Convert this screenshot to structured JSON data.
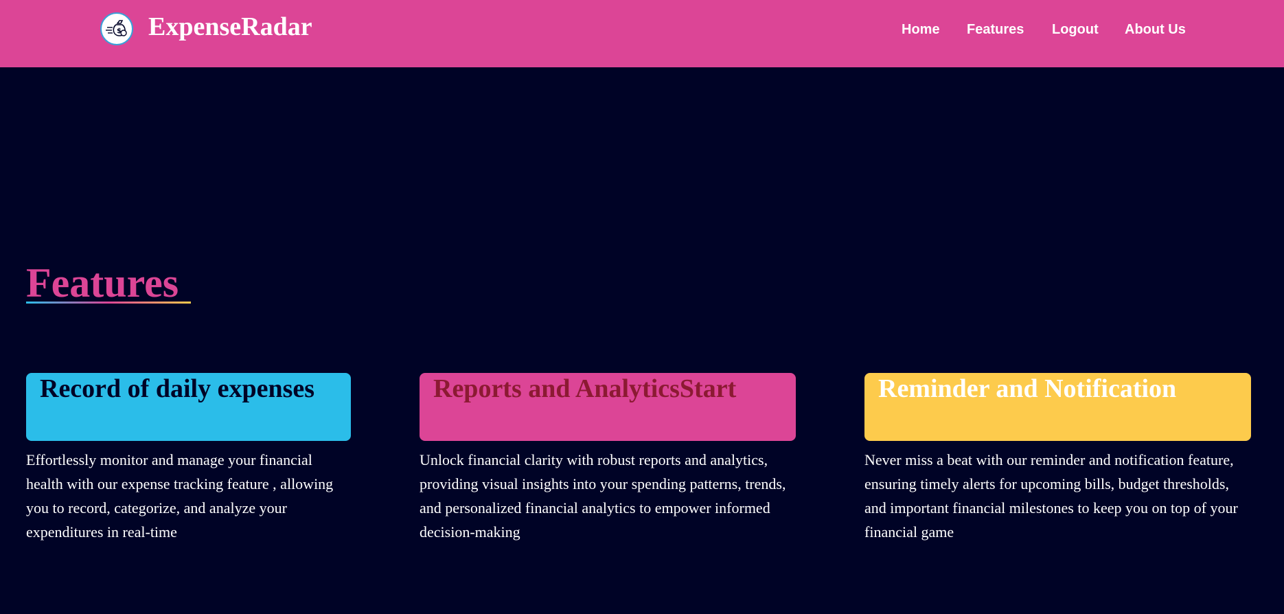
{
  "header": {
    "brand": "ExpenseRadar",
    "logo_icon": "money-bag-icon",
    "nav": {
      "home": "Home",
      "features": "Features",
      "logout": "Logout",
      "about": "About Us"
    }
  },
  "section": {
    "title": "Features"
  },
  "features": [
    {
      "title": "Record of daily expenses",
      "description": "Effortlessly monitor and manage your financial health with our expense tracking feature , allowing you to record, categorize, and analyze your expenditures in real-time"
    },
    {
      "title": "Reports and AnalyticsStart",
      "description": "Unlock financial clarity with robust reports and analytics, providing visual insights into your spending patterns, trends, and personalized financial analytics to empower informed decision-making"
    },
    {
      "title": "Reminder and Notification",
      "description": "Never miss a beat with our reminder and notification feature, ensuring timely alerts for upcoming bills, budget thresholds, and important financial milestones to keep you on top of your financial game"
    }
  ],
  "colors": {
    "background": "#000326",
    "navbar": "#dc4596",
    "card_blue": "#2bbde9",
    "card_pink": "#dc4596",
    "card_yellow": "#fdcb4c"
  }
}
